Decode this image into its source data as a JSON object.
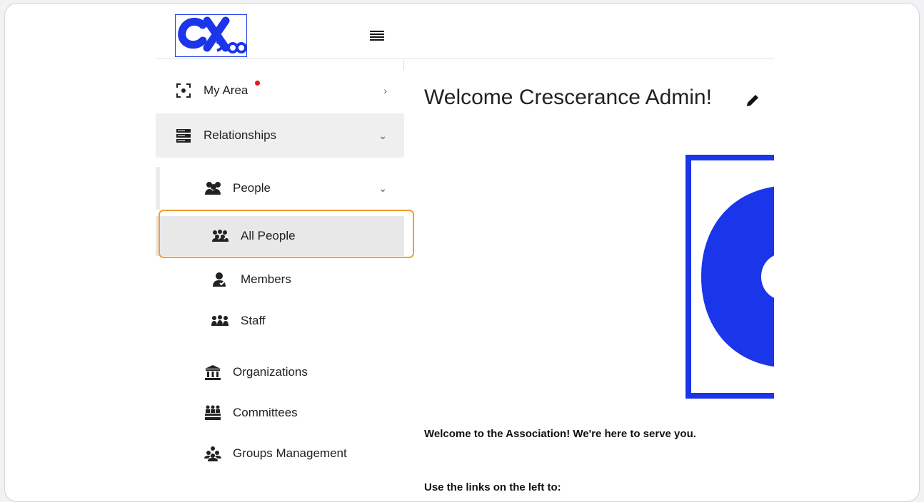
{
  "colors": {
    "brand_blue": "#1a35ea",
    "highlight": "#f0a030",
    "notification": "#e21a1a",
    "active_bg": "#e8e8e8"
  },
  "header": {
    "logo_text": "CXsba",
    "menu_icon": "hamburger-icon"
  },
  "sidebar": {
    "items": [
      {
        "label": "My Area",
        "icon": "focus-frame-icon",
        "chevron": "›",
        "has_notification": true
      },
      {
        "label": "Relationships",
        "icon": "server-stack-icon",
        "chevron": "⌄"
      },
      {
        "label": "People",
        "icon": "people-group-icon",
        "chevron": "⌄"
      },
      {
        "label": "All People",
        "icon": "crowd-icon",
        "active": true
      },
      {
        "label": "Members",
        "icon": "member-check-icon"
      },
      {
        "label": "Staff",
        "icon": "staff-group-icon"
      },
      {
        "label": "Organizations",
        "icon": "bank-building-icon"
      },
      {
        "label": "Committees",
        "icon": "committee-seats-icon"
      },
      {
        "label": "Groups Management",
        "icon": "groups-icon"
      }
    ]
  },
  "main": {
    "welcome": "Welcome Crescerance Admin!",
    "intro": "Welcome to the Association!  We're here to serve you.",
    "use_links": "Use the links on the left to:"
  }
}
